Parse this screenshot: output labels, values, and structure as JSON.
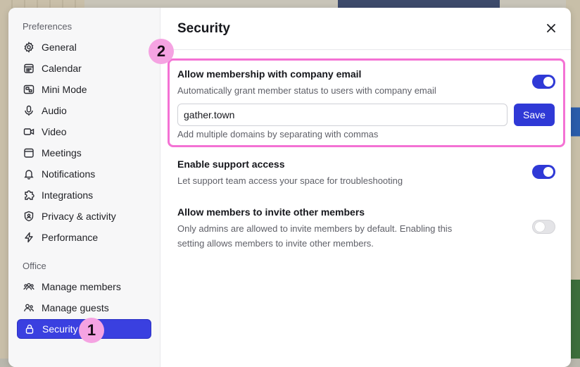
{
  "sidebar": {
    "sections": [
      {
        "label": "Preferences",
        "items": [
          {
            "label": "General",
            "icon": "gear-icon"
          },
          {
            "label": "Calendar",
            "icon": "calendar-icon"
          },
          {
            "label": "Mini Mode",
            "icon": "mini-mode-icon"
          },
          {
            "label": "Audio",
            "icon": "microphone-icon"
          },
          {
            "label": "Video",
            "icon": "video-camera-icon"
          },
          {
            "label": "Meetings",
            "icon": "meetings-icon"
          },
          {
            "label": "Notifications",
            "icon": "bell-icon"
          },
          {
            "label": "Integrations",
            "icon": "puzzle-icon"
          },
          {
            "label": "Privacy & activity",
            "icon": "shield-user-icon"
          },
          {
            "label": "Performance",
            "icon": "lightning-icon"
          }
        ]
      },
      {
        "label": "Office",
        "items": [
          {
            "label": "Manage members",
            "icon": "members-icon"
          },
          {
            "label": "Manage guests",
            "icon": "guests-icon"
          },
          {
            "label": "Security",
            "icon": "lock-icon",
            "active": true
          }
        ]
      }
    ]
  },
  "main": {
    "title": "Security",
    "settings": [
      {
        "title": "Allow membership with company email",
        "description": "Automatically grant member status to users with company email",
        "enabled": true,
        "input_value": "gather.town",
        "save_label": "Save",
        "hint": "Add multiple domains by separating with commas"
      },
      {
        "title": "Enable support access",
        "description": "Let support team access your space for troubleshooting",
        "enabled": true
      },
      {
        "title": "Allow members to invite other members",
        "description_line1": "Only admins are allowed to invite members by default. Enabling this",
        "description_line2": "setting allows members to invite other members.",
        "enabled": false
      }
    ]
  },
  "annotations": {
    "badge1": "1",
    "badge2": "2"
  },
  "colors": {
    "accent": "#2f39d6",
    "active_nav": "#3a40e0",
    "highlight": "#f472d4",
    "badge": "#f5a3e2"
  }
}
